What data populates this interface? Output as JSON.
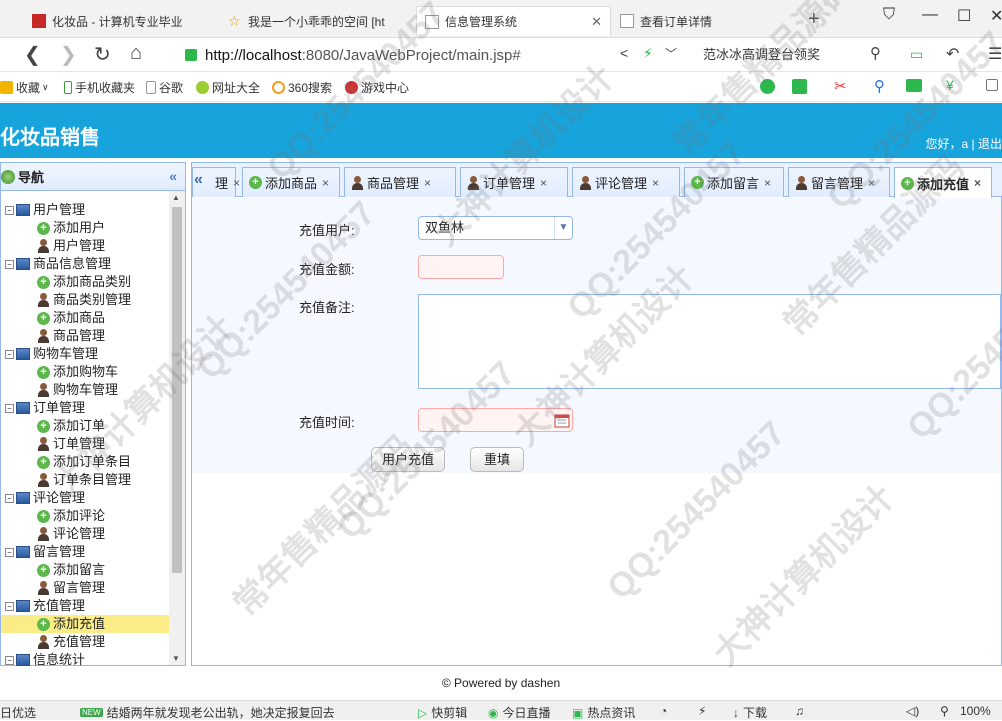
{
  "browser": {
    "tabs": [
      {
        "label": "化妆品 - 计算机专业毕业"
      },
      {
        "label": "我是一个小乖乖的空间 [ht"
      },
      {
        "label": "信息管理系统"
      },
      {
        "label": "查看订单详情"
      }
    ],
    "url": {
      "host": "http://localhost",
      "rest": ":8080/JavaWebProject/main.jsp#"
    },
    "search_text": "范冰冰高调登台领奖",
    "bookmarks": [
      "收藏",
      "手机收藏夹",
      "谷歌",
      "网址大全",
      "360搜索",
      "游戏中心"
    ]
  },
  "app": {
    "title": "化妆品销售",
    "greeting": "您好，a | 退出"
  },
  "sidebar": {
    "title": "导航",
    "groups": [
      {
        "label": "用户管理",
        "children": [
          "添加用户",
          "用户管理"
        ]
      },
      {
        "label": "商品信息管理",
        "children": [
          "添加商品类别",
          "商品类别管理",
          "添加商品",
          "商品管理"
        ]
      },
      {
        "label": "购物车管理",
        "children": [
          "添加购物车",
          "购物车管理"
        ]
      },
      {
        "label": "订单管理",
        "children": [
          "添加订单",
          "订单管理",
          "添加订单条目",
          "订单条目管理"
        ]
      },
      {
        "label": "评论管理",
        "children": [
          "添加评论",
          "评论管理"
        ]
      },
      {
        "label": "留言管理",
        "children": [
          "添加留言",
          "留言管理"
        ]
      },
      {
        "label": "充值管理",
        "children": [
          "添加充值",
          "充值管理"
        ]
      },
      {
        "label": "信息统计",
        "children": []
      }
    ],
    "selected": "添加充值"
  },
  "tabs": {
    "partial": "理",
    "items": [
      "添加商品",
      "商品管理",
      "订单管理",
      "评论管理",
      "添加留言",
      "留言管理",
      "添加充值"
    ],
    "active": "添加充值"
  },
  "form": {
    "user_label": "充值用户:",
    "user_value": "双鱼林",
    "amount_label": "充值金额:",
    "amount_value": "",
    "memo_label": "充值备注:",
    "memo_value": "",
    "time_label": "充值时间:",
    "time_value": "",
    "submit_label": "用户充值",
    "reset_label": "重填"
  },
  "footer": "© Powered by dashen",
  "statusbar": {
    "left": "日优选",
    "news_badge": "NEW",
    "news": "结婚两年就发现老公出轨，她决定报复回去",
    "items": [
      "快剪辑",
      "今日直播",
      "热点资讯",
      "下载"
    ],
    "zoom": "100%"
  },
  "watermarks": [
    "QQ:254540457",
    "大神计算机设计",
    "常年售精品源码"
  ]
}
